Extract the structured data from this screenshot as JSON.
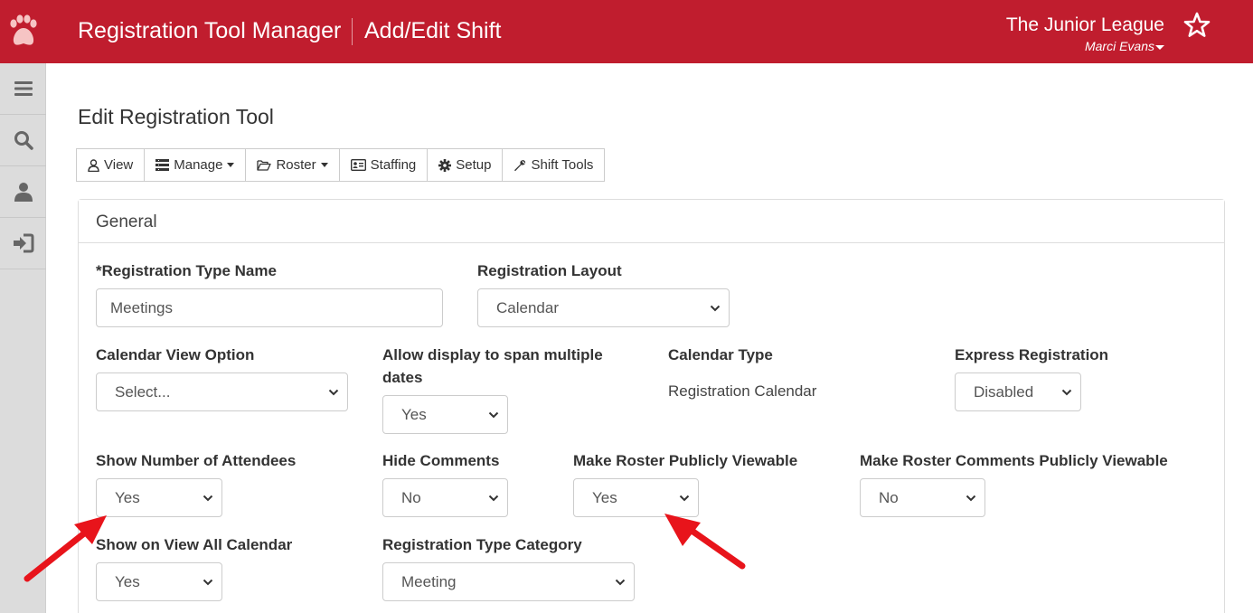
{
  "header": {
    "app_title": "Registration Tool Manager",
    "page_crumb": "Add/Edit Shift",
    "org_name": "The Junior League",
    "user_name": "Marci Evans",
    "logo_icon": "paw-icon",
    "favorite_icon": "star-icon"
  },
  "sidebar": {
    "items": [
      {
        "icon": "menu-icon"
      },
      {
        "icon": "search-icon"
      },
      {
        "icon": "user-icon"
      },
      {
        "icon": "logout-icon"
      }
    ]
  },
  "page": {
    "title": "Edit Registration Tool"
  },
  "toolbar": {
    "view_label": "View",
    "manage_label": "Manage",
    "roster_label": "Roster",
    "staffing_label": "Staffing",
    "setup_label": "Setup",
    "shift_tools_label": "Shift Tools"
  },
  "panel": {
    "heading": "General"
  },
  "form": {
    "registration_type_name": {
      "label": "*Registration Type Name",
      "value": "Meetings"
    },
    "registration_layout": {
      "label": "Registration Layout",
      "value": "Calendar"
    },
    "calendar_view_option": {
      "label": "Calendar View Option",
      "value": "Select..."
    },
    "allow_span_dates": {
      "label": "Allow display to span multiple dates",
      "value": "Yes"
    },
    "calendar_type": {
      "label": "Calendar Type",
      "value": "Registration Calendar"
    },
    "express_registration": {
      "label": "Express Registration",
      "value": "Disabled"
    },
    "show_number_attendees": {
      "label": "Show Number of Attendees",
      "value": "Yes"
    },
    "hide_comments": {
      "label": "Hide Comments",
      "value": "No"
    },
    "roster_public": {
      "label": "Make Roster Publicly Viewable",
      "value": "Yes"
    },
    "roster_comments_public": {
      "label": "Make Roster Comments Publicly Viewable",
      "value": "No"
    },
    "show_on_view_all": {
      "label": "Show on View All Calendar",
      "value": "Yes"
    },
    "registration_type_category": {
      "label": "Registration Type Category",
      "value": "Meeting"
    }
  },
  "colors": {
    "brand_red": "#c01d2e",
    "annotation_arrow": "#e8141b",
    "sidebar_bg": "#dcdcdc"
  }
}
